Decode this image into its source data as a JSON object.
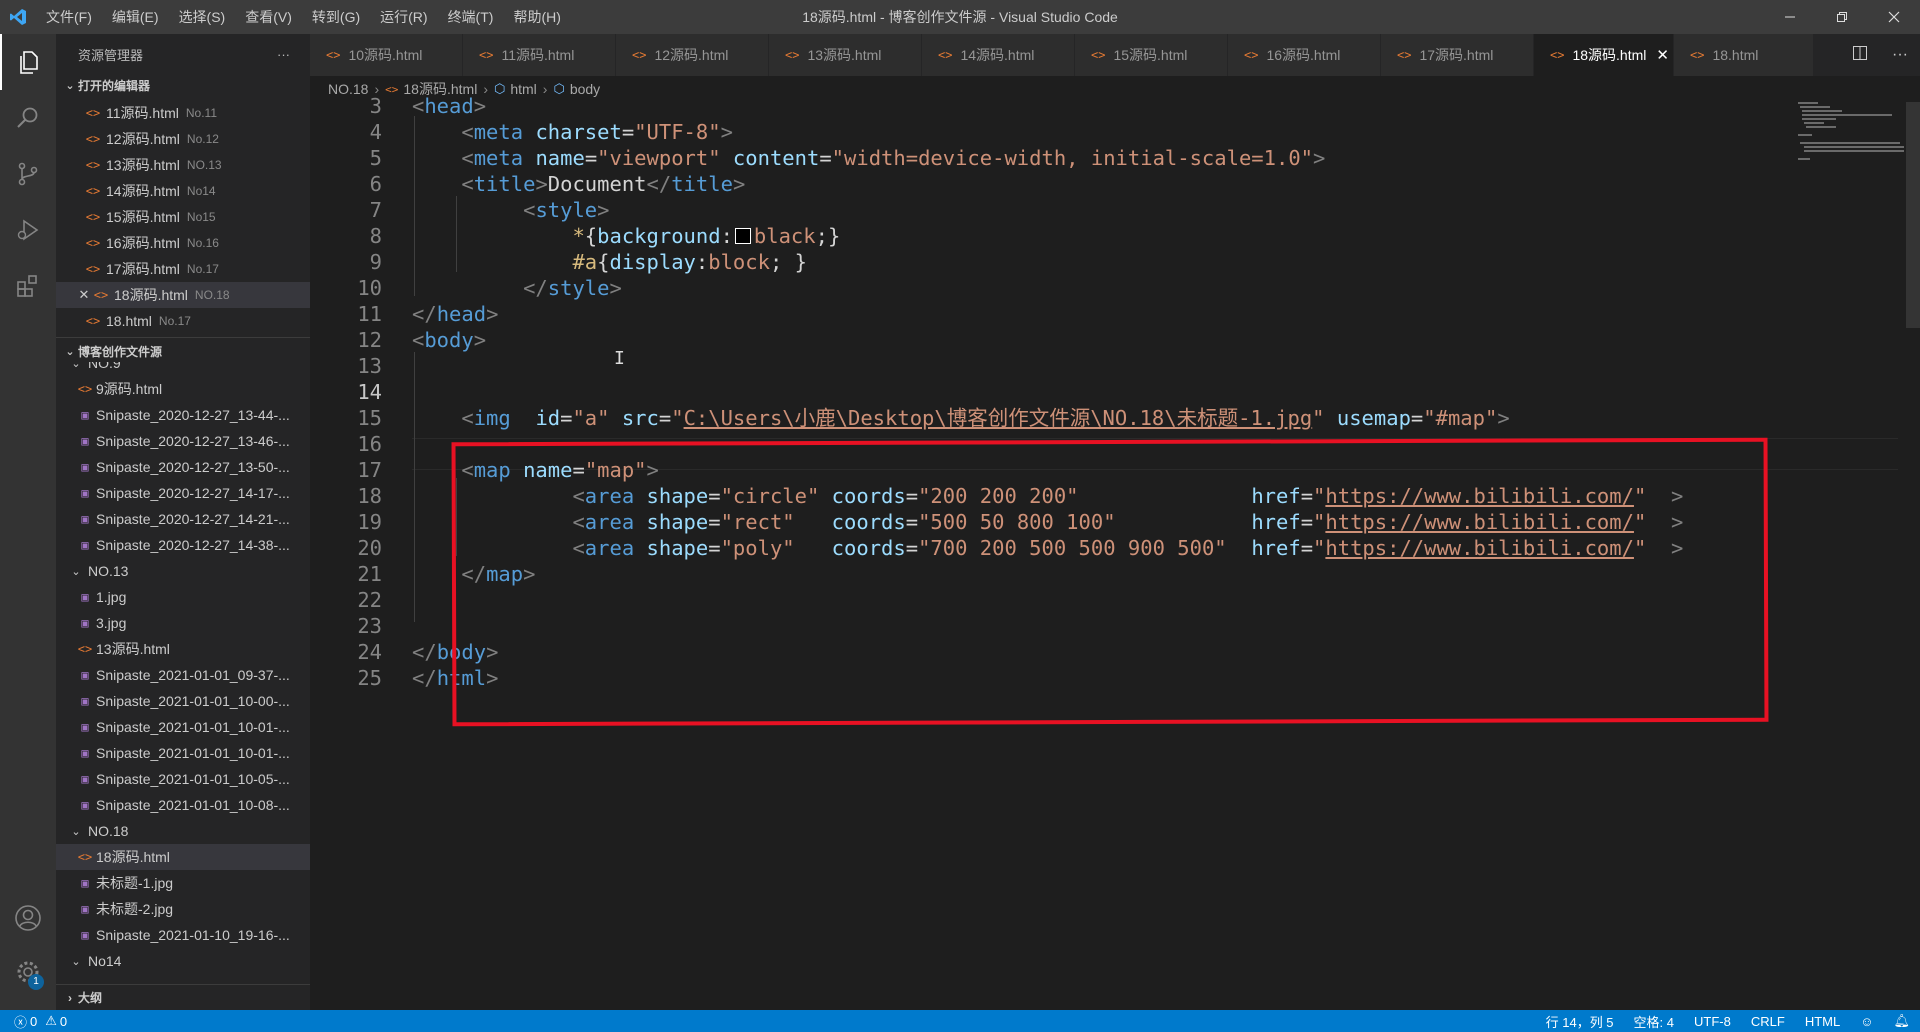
{
  "window": {
    "title": "18源码.html - 博客创作文件源 - Visual Studio Code",
    "menus": [
      "文件(F)",
      "编辑(E)",
      "选择(S)",
      "查看(V)",
      "转到(G)",
      "运行(R)",
      "终端(T)",
      "帮助(H)"
    ]
  },
  "sidebar": {
    "title": "资源管理器",
    "more": "···",
    "open_editors": {
      "header": "打开的编辑器",
      "items": [
        {
          "name": "11源码.html",
          "desc": "No.11"
        },
        {
          "name": "12源码.html",
          "desc": "No.12"
        },
        {
          "name": "13源码.html",
          "desc": "NO.13"
        },
        {
          "name": "14源码.html",
          "desc": "No14"
        },
        {
          "name": "15源码.html",
          "desc": "No15"
        },
        {
          "name": "16源码.html",
          "desc": "No.16"
        },
        {
          "name": "17源码.html",
          "desc": "No.17"
        },
        {
          "name": "18源码.html",
          "desc": "NO.18"
        },
        {
          "name": "18.html",
          "desc": "No.17"
        }
      ]
    },
    "workspace": {
      "header": "博客创作文件源",
      "folder_no9": "NO.9",
      "no9_items": [
        "9源码.html",
        "Snipaste_2020-12-27_13-44-...",
        "Snipaste_2020-12-27_13-46-...",
        "Snipaste_2020-12-27_13-50-...",
        "Snipaste_2020-12-27_14-17-...",
        "Snipaste_2020-12-27_14-21-...",
        "Snipaste_2020-12-27_14-38-..."
      ],
      "folder_no13": "NO.13",
      "no13_items": [
        "1.jpg",
        "3.jpg",
        "13源码.html",
        "Snipaste_2021-01-01_09-37-...",
        "Snipaste_2021-01-01_10-00-...",
        "Snipaste_2021-01-01_10-01-...",
        "Snipaste_2021-01-01_10-01-...",
        "Snipaste_2021-01-01_10-05-...",
        "Snipaste_2021-01-01_10-08-..."
      ],
      "folder_no18": "NO.18",
      "no18_items": [
        "18源码.html",
        "未标题-1.jpg",
        "未标题-2.jpg",
        "Snipaste_2021-01-10_19-16-..."
      ],
      "folder_no14": "No14"
    },
    "outline": "大纲"
  },
  "tabs": [
    "10源码.html",
    "11源码.html",
    "12源码.html",
    "13源码.html",
    "14源码.html",
    "15源码.html",
    "16源码.html",
    "17源码.html",
    "18源码.html",
    "18.html"
  ],
  "breadcrumb": [
    "NO.18",
    "18源码.html",
    "html",
    "body"
  ],
  "editor": {
    "line_numbers": [
      "3",
      "4",
      "5",
      "6",
      "7",
      "8",
      "9",
      "10",
      "11",
      "12",
      "13",
      "14",
      "15",
      "16",
      "17",
      "18",
      "19",
      "20",
      "21",
      "22",
      "23",
      "24",
      "25"
    ],
    "code": {
      "l3_tag": "head",
      "l4_tag": "meta",
      "l4_attr": "charset",
      "l4_val": "\"UTF-8\"",
      "l5_tag": "meta",
      "l5_attr1": "name",
      "l5_val1": "\"viewport\"",
      "l5_attr2": "content",
      "l5_val2": "\"width=device-width, initial-scale=1.0\"",
      "l6_tag": "title",
      "l6_text": "Document",
      "l7_tag": "style",
      "l8_sel": "*",
      "l8_prop": "background",
      "l8_val": "black",
      "l9_sel": "#a",
      "l9_prop": "display",
      "l9_val": "block",
      "l10_tag": "style",
      "l11_tag": "head",
      "l12_tag": "body",
      "l15_tag": "img",
      "l15_id_attr": "id",
      "l15_id_val": "\"a\"",
      "l15_src_attr": "src",
      "l15_src_q1": "\"",
      "l15_src_url": "C:\\Users\\小鹿\\Desktop\\博客创作文件源\\NO.18\\未标题-1.jpg",
      "l15_src_q2": "\"",
      "l15_usemap_attr": "usemap",
      "l15_usemap_val": "\"#map\"",
      "l17_tag": "map",
      "l17_attr": "name",
      "l17_val": "\"map\"",
      "area_tag": "area",
      "areas": [
        {
          "shape": "\"circle\"",
          "coords": "\"200 200 200\"",
          "href": "https://www.bilibili.com/"
        },
        {
          "shape": "\"rect\"",
          "coords": "\"500 50 800 100\"",
          "href": "https://www.bilibili.com/"
        },
        {
          "shape": "\"poly\"",
          "coords": "\"700 200 500 500 900 500\"",
          "href": "https://www.bilibili.com/"
        }
      ],
      "attr_shape": "shape",
      "attr_coords": "coords",
      "attr_href": "href",
      "l21_tag": "map",
      "l24_tag": "body",
      "l25_tag": "html"
    }
  },
  "statusbar": {
    "errors": "0",
    "warnings": "0",
    "position": "行 14，列 5",
    "spaces": "空格: 4",
    "encoding": "UTF-8",
    "eol": "CRLF",
    "language": "HTML"
  },
  "colors": {
    "accent": "#007acc",
    "highlight_box": "#e81123",
    "html_icon": "#e37933",
    "image_icon": "#a074c4"
  }
}
